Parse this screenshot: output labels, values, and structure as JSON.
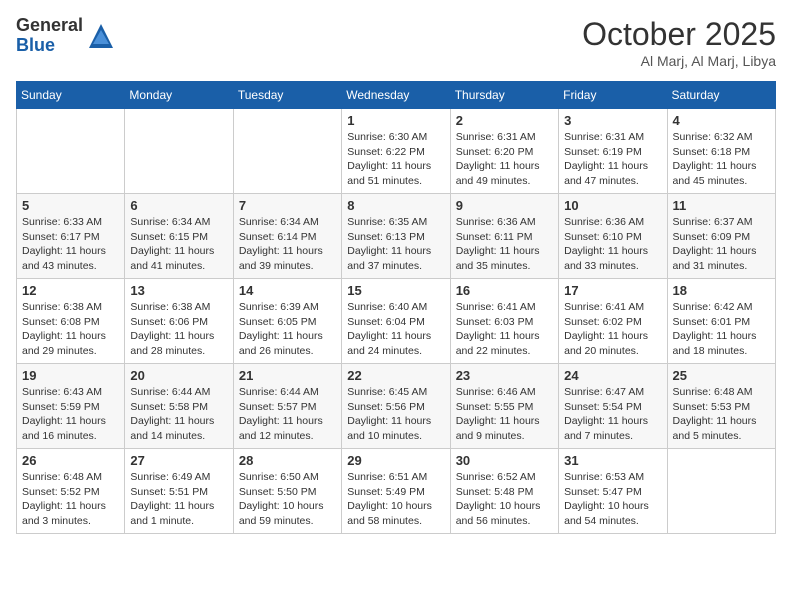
{
  "header": {
    "logo_general": "General",
    "logo_blue": "Blue",
    "month_title": "October 2025",
    "location": "Al Marj, Al Marj, Libya"
  },
  "days_of_week": [
    "Sunday",
    "Monday",
    "Tuesday",
    "Wednesday",
    "Thursday",
    "Friday",
    "Saturday"
  ],
  "weeks": [
    [
      {
        "day": "",
        "info": ""
      },
      {
        "day": "",
        "info": ""
      },
      {
        "day": "",
        "info": ""
      },
      {
        "day": "1",
        "info": "Sunrise: 6:30 AM\nSunset: 6:22 PM\nDaylight: 11 hours\nand 51 minutes."
      },
      {
        "day": "2",
        "info": "Sunrise: 6:31 AM\nSunset: 6:20 PM\nDaylight: 11 hours\nand 49 minutes."
      },
      {
        "day": "3",
        "info": "Sunrise: 6:31 AM\nSunset: 6:19 PM\nDaylight: 11 hours\nand 47 minutes."
      },
      {
        "day": "4",
        "info": "Sunrise: 6:32 AM\nSunset: 6:18 PM\nDaylight: 11 hours\nand 45 minutes."
      }
    ],
    [
      {
        "day": "5",
        "info": "Sunrise: 6:33 AM\nSunset: 6:17 PM\nDaylight: 11 hours\nand 43 minutes."
      },
      {
        "day": "6",
        "info": "Sunrise: 6:34 AM\nSunset: 6:15 PM\nDaylight: 11 hours\nand 41 minutes."
      },
      {
        "day": "7",
        "info": "Sunrise: 6:34 AM\nSunset: 6:14 PM\nDaylight: 11 hours\nand 39 minutes."
      },
      {
        "day": "8",
        "info": "Sunrise: 6:35 AM\nSunset: 6:13 PM\nDaylight: 11 hours\nand 37 minutes."
      },
      {
        "day": "9",
        "info": "Sunrise: 6:36 AM\nSunset: 6:11 PM\nDaylight: 11 hours\nand 35 minutes."
      },
      {
        "day": "10",
        "info": "Sunrise: 6:36 AM\nSunset: 6:10 PM\nDaylight: 11 hours\nand 33 minutes."
      },
      {
        "day": "11",
        "info": "Sunrise: 6:37 AM\nSunset: 6:09 PM\nDaylight: 11 hours\nand 31 minutes."
      }
    ],
    [
      {
        "day": "12",
        "info": "Sunrise: 6:38 AM\nSunset: 6:08 PM\nDaylight: 11 hours\nand 29 minutes."
      },
      {
        "day": "13",
        "info": "Sunrise: 6:38 AM\nSunset: 6:06 PM\nDaylight: 11 hours\nand 28 minutes."
      },
      {
        "day": "14",
        "info": "Sunrise: 6:39 AM\nSunset: 6:05 PM\nDaylight: 11 hours\nand 26 minutes."
      },
      {
        "day": "15",
        "info": "Sunrise: 6:40 AM\nSunset: 6:04 PM\nDaylight: 11 hours\nand 24 minutes."
      },
      {
        "day": "16",
        "info": "Sunrise: 6:41 AM\nSunset: 6:03 PM\nDaylight: 11 hours\nand 22 minutes."
      },
      {
        "day": "17",
        "info": "Sunrise: 6:41 AM\nSunset: 6:02 PM\nDaylight: 11 hours\nand 20 minutes."
      },
      {
        "day": "18",
        "info": "Sunrise: 6:42 AM\nSunset: 6:01 PM\nDaylight: 11 hours\nand 18 minutes."
      }
    ],
    [
      {
        "day": "19",
        "info": "Sunrise: 6:43 AM\nSunset: 5:59 PM\nDaylight: 11 hours\nand 16 minutes."
      },
      {
        "day": "20",
        "info": "Sunrise: 6:44 AM\nSunset: 5:58 PM\nDaylight: 11 hours\nand 14 minutes."
      },
      {
        "day": "21",
        "info": "Sunrise: 6:44 AM\nSunset: 5:57 PM\nDaylight: 11 hours\nand 12 minutes."
      },
      {
        "day": "22",
        "info": "Sunrise: 6:45 AM\nSunset: 5:56 PM\nDaylight: 11 hours\nand 10 minutes."
      },
      {
        "day": "23",
        "info": "Sunrise: 6:46 AM\nSunset: 5:55 PM\nDaylight: 11 hours\nand 9 minutes."
      },
      {
        "day": "24",
        "info": "Sunrise: 6:47 AM\nSunset: 5:54 PM\nDaylight: 11 hours\nand 7 minutes."
      },
      {
        "day": "25",
        "info": "Sunrise: 6:48 AM\nSunset: 5:53 PM\nDaylight: 11 hours\nand 5 minutes."
      }
    ],
    [
      {
        "day": "26",
        "info": "Sunrise: 6:48 AM\nSunset: 5:52 PM\nDaylight: 11 hours\nand 3 minutes."
      },
      {
        "day": "27",
        "info": "Sunrise: 6:49 AM\nSunset: 5:51 PM\nDaylight: 11 hours\nand 1 minute."
      },
      {
        "day": "28",
        "info": "Sunrise: 6:50 AM\nSunset: 5:50 PM\nDaylight: 10 hours\nand 59 minutes."
      },
      {
        "day": "29",
        "info": "Sunrise: 6:51 AM\nSunset: 5:49 PM\nDaylight: 10 hours\nand 58 minutes."
      },
      {
        "day": "30",
        "info": "Sunrise: 6:52 AM\nSunset: 5:48 PM\nDaylight: 10 hours\nand 56 minutes."
      },
      {
        "day": "31",
        "info": "Sunrise: 6:53 AM\nSunset: 5:47 PM\nDaylight: 10 hours\nand 54 minutes."
      },
      {
        "day": "",
        "info": ""
      }
    ]
  ]
}
